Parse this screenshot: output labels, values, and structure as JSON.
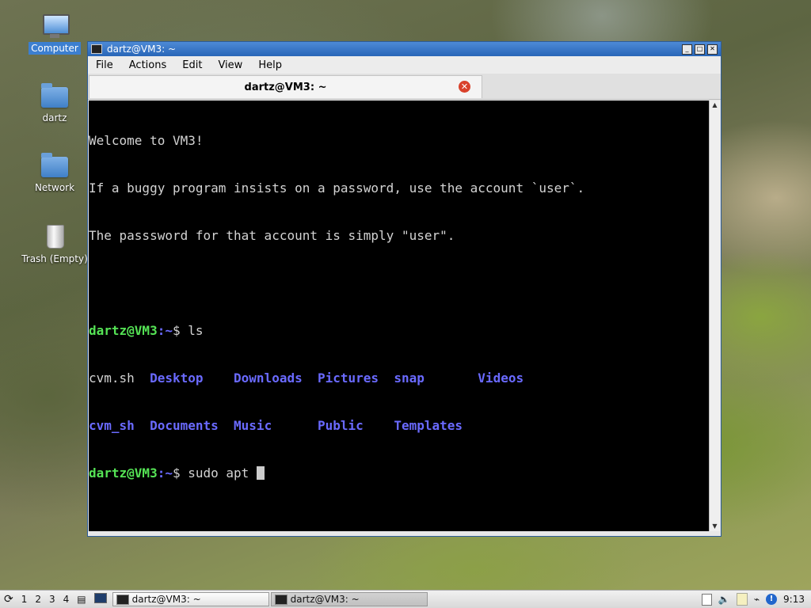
{
  "desktop": {
    "icons": [
      {
        "label": "Computer",
        "icon": "computer-icon"
      },
      {
        "label": "dartz",
        "icon": "home-folder-icon"
      },
      {
        "label": "Network",
        "icon": "network-folder-icon"
      },
      {
        "label": "Trash (Empty)",
        "icon": "trash-icon"
      }
    ]
  },
  "window": {
    "title": "dartz@VM3: ~",
    "menu": [
      "File",
      "Actions",
      "Edit",
      "View",
      "Help"
    ],
    "tab_label": "dartz@VM3: ~",
    "controls": {
      "minimize": "minimize-icon",
      "maximize": "maximize-icon",
      "close": "close-icon"
    }
  },
  "terminal": {
    "welcome": [
      "Welcome to VM3!",
      "If a buggy program insists on a password, use the account `user`.",
      "The passsword for that account is simply \"user\"."
    ],
    "prompt_user": "dartz@VM3",
    "prompt_path": ":~",
    "prompt_sign": "$ ",
    "cmd1": "ls",
    "ls_row1": [
      {
        "text": "cvm.sh",
        "dir": false
      },
      {
        "text": "Desktop",
        "dir": true
      },
      {
        "text": "Downloads",
        "dir": true
      },
      {
        "text": "Pictures",
        "dir": true
      },
      {
        "text": "snap",
        "dir": true
      },
      {
        "text": "Videos",
        "dir": true
      }
    ],
    "ls_row2": [
      {
        "text": "cvm_sh",
        "dir": true
      },
      {
        "text": "Documents",
        "dir": true
      },
      {
        "text": "Music",
        "dir": true
      },
      {
        "text": "Public",
        "dir": true
      },
      {
        "text": "Templates",
        "dir": true
      }
    ],
    "cmd2": "sudo apt ",
    "colors": {
      "prompt": "#55e355",
      "dir": "#6a6aff",
      "text": "#d3d3d3",
      "background": "#000000"
    }
  },
  "taskbar": {
    "workspaces": [
      "1",
      "2",
      "3",
      "4"
    ],
    "tasks": [
      {
        "label": "dartz@VM3: ~"
      },
      {
        "label": "dartz@VM3: ~"
      }
    ],
    "clock": "9:13"
  }
}
